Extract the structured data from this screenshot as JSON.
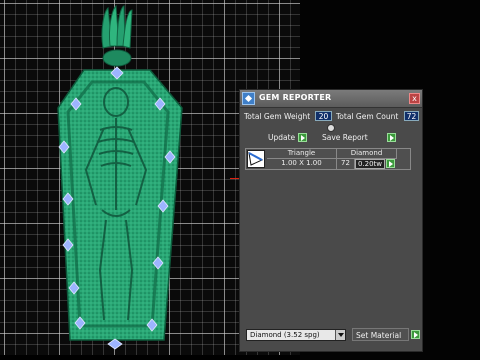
{
  "panel": {
    "title": "GEM REPORTER",
    "close_glyph": "x",
    "total_weight_label": "Total Gem Weight",
    "total_weight_value": "20",
    "total_count_label": "Total Gem Count",
    "total_count_value": "72",
    "update_label": "Update",
    "save_report_label": "Save Report",
    "table": {
      "shape": "Triangle",
      "stone": "Diamond",
      "size": "1.00 X 1.00",
      "count": "72",
      "weight": "0.20tw"
    },
    "material_value": "Diamond   (3.52 spg)",
    "set_material_label": "Set Material"
  },
  "colors": {
    "pendant_green": "#2aa876",
    "gem_blue": "#9db4ff",
    "panel_bg": "#4a4a4a",
    "accent_green": "#3c9a3c"
  },
  "icons": [
    "app-logo-icon",
    "close-icon",
    "knob-icon",
    "play-icon",
    "dropdown-arrow-icon",
    "gem-triangle-icon"
  ]
}
